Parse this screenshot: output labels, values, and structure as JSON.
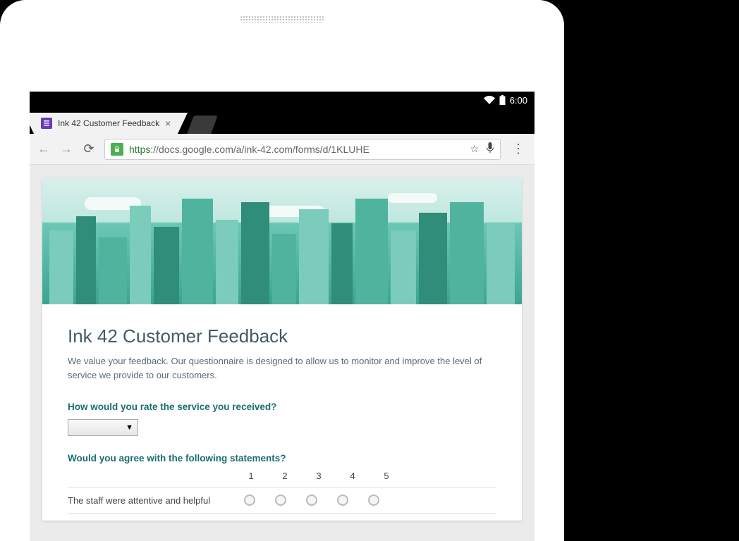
{
  "statusbar": {
    "time": "6:00"
  },
  "browser": {
    "tab_title": "Ink 42 Customer Feedback",
    "url_scheme": "https",
    "url_rest": "://docs.google.com/a/ink-42.com/forms/d/1KLUHE"
  },
  "form": {
    "title": "Ink 42 Customer Feedback",
    "description": "We value your feedback. Our questionnaire is designed to allow us to monitor and improve the level of service we provide to our customers.",
    "q1_label": "How would you rate the service you received?",
    "q2_label": "Would you agree with the following statements?",
    "grid_headers": [
      "1",
      "2",
      "3",
      "4",
      "5"
    ],
    "grid_rows": [
      {
        "label": "The staff were attentive and helpful"
      }
    ]
  }
}
